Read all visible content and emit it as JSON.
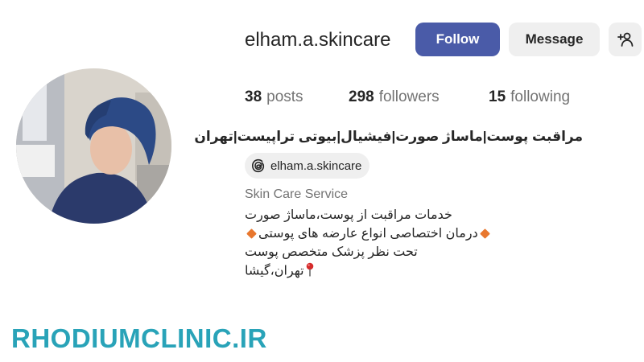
{
  "profile": {
    "username": "elham.a.skincare",
    "threads_handle": "elham.a.skincare",
    "category": "Skin Care Service",
    "bio_title": "مراقبت پوست|ماساژ صورت|فیشیال|بیوتی تراپیست|تهران",
    "bio_lines": [
      "خدمات مراقبت از پوست،ماساژ صورت",
      "درمان اختصاصی انواع عارضه های پوستی",
      "تحت نظر پزشک متخصص پوست",
      "تهران،گیشا"
    ]
  },
  "actions": {
    "follow_label": "Follow",
    "message_label": "Message",
    "add_user_icon": "person-plus-icon"
  },
  "stats": {
    "posts_count": "38",
    "posts_label": "posts",
    "followers_count": "298",
    "followers_label": "followers",
    "following_count": "15",
    "following_label": "following"
  },
  "watermark": "RHODIUMCLINIC.IR",
  "colors": {
    "follow_button": "#4a5ba8",
    "watermark": "#29a3b8",
    "diamond": "#e8772e",
    "pin": "#d62b2b"
  }
}
